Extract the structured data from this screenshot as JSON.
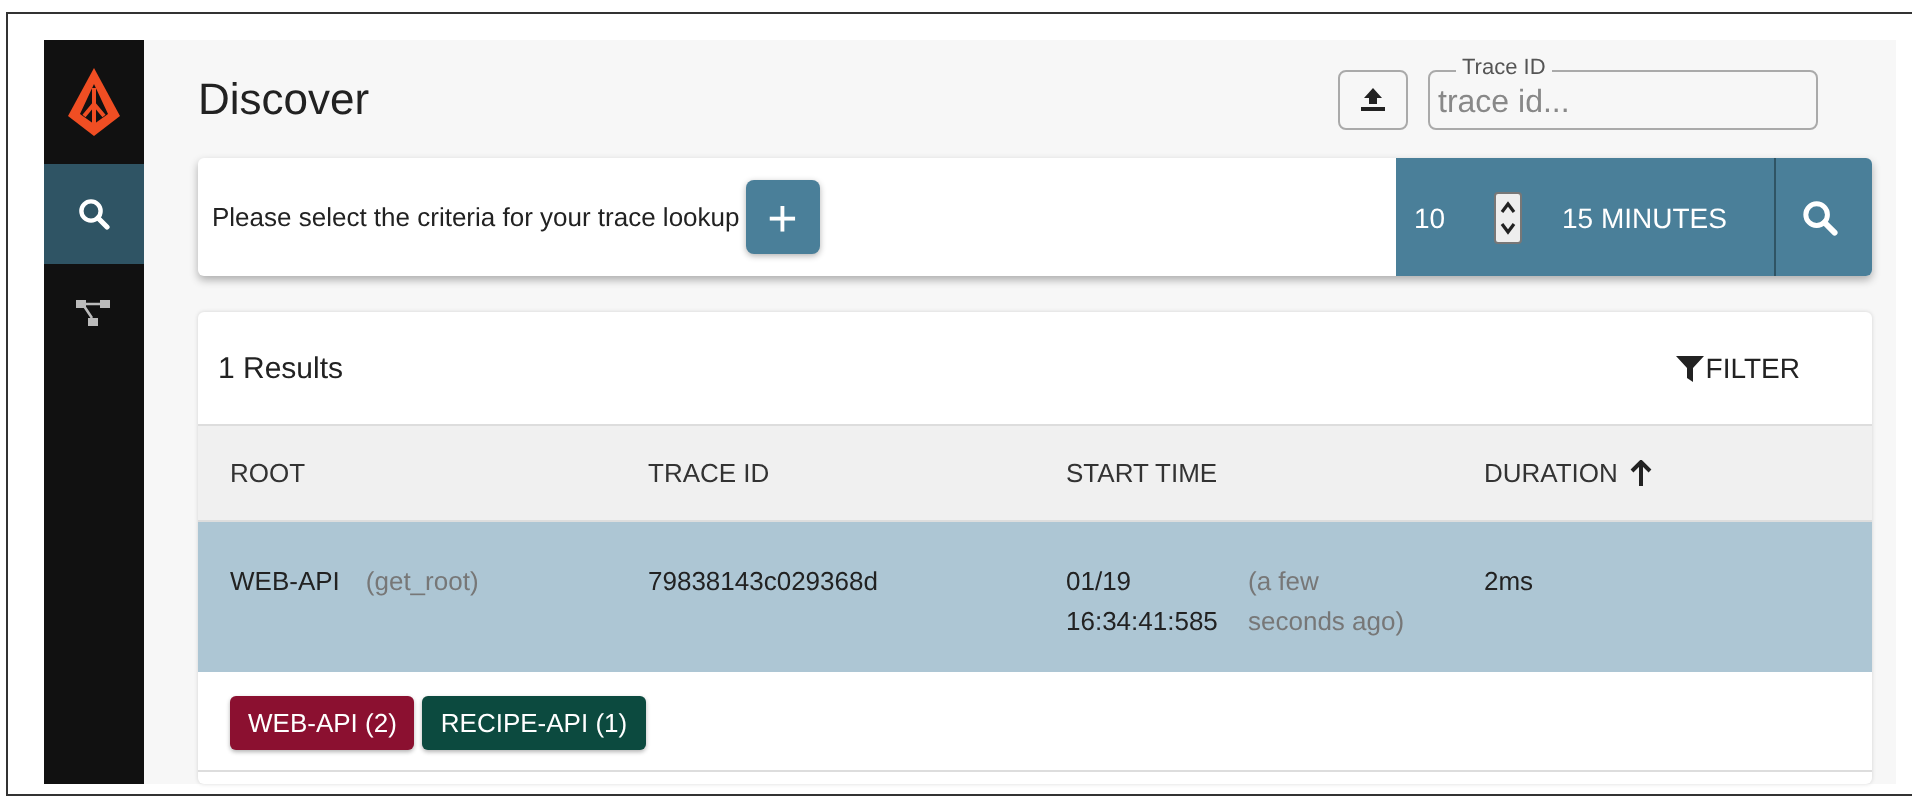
{
  "sidebar": {
    "items": [
      {
        "kind": "search",
        "selected": true
      },
      {
        "kind": "tree",
        "selected": false
      }
    ]
  },
  "header": {
    "title": "Discover",
    "trace_id_field": {
      "label": "Trace ID",
      "placeholder": "trace id..."
    }
  },
  "criteria": {
    "prompt": "Please select the criteria for your trace lookup",
    "add_button": "+",
    "lookback_value": "10",
    "lookback_unit": "15 MINUTES"
  },
  "results": {
    "count_label": "1 Results",
    "filter_button": "FILTER",
    "columns": [
      {
        "label": "ROOT",
        "sorted": false
      },
      {
        "label": "TRACE ID",
        "sorted": false
      },
      {
        "label": "START TIME",
        "sorted": false
      },
      {
        "label": "DURATION",
        "sorted": true
      }
    ],
    "rows": [
      {
        "selected": true,
        "root_service": "WEB-API",
        "root_span": "(get_root)",
        "trace_id": "79838143c029368d",
        "start_date": "01/19",
        "start_time": "16:34:41:585",
        "relative_time": "(a few seconds ago)",
        "duration": "2ms",
        "tags": [
          {
            "label": "WEB-API (2)",
            "color": "#8b1030"
          },
          {
            "label": "RECIPE-API (1)",
            "color": "#0c4a3f"
          }
        ]
      }
    ]
  }
}
